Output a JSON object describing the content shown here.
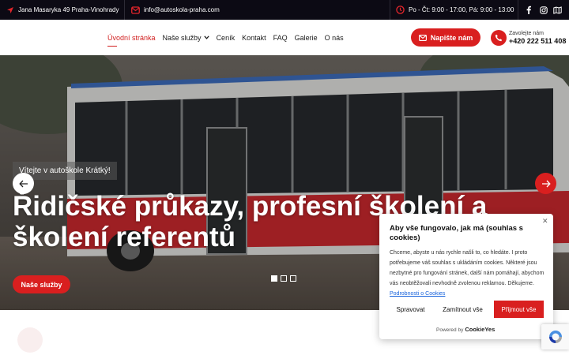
{
  "topbar": {
    "address": "Jana Masaryka 49 Praha-Vinohrady",
    "email": "info@autoskola-praha.com",
    "hours": "Po - Čt: 9:00 - 17:00, Pá: 9:00 - 13:00",
    "social_icons": [
      "facebook-icon",
      "instagram-icon",
      "map-icon"
    ]
  },
  "header": {
    "nav": [
      {
        "label": "Úvodní stránka",
        "active": true
      },
      {
        "label": "Naše služby",
        "dropdown": true
      },
      {
        "label": "Ceník"
      },
      {
        "label": "Kontakt"
      },
      {
        "label": "FAQ"
      },
      {
        "label": "Galerie"
      },
      {
        "label": "O nás"
      }
    ],
    "cta_label": "Napište nám",
    "phone_label": "Zavolejte nám",
    "phone_number": "+420 222 511 408"
  },
  "hero": {
    "tagline": "Vítejte v autoškole Krátký!",
    "title": "Řidičské průkazy, profesní školení a školení referentů",
    "button_label": "Naše služby",
    "slides_count": 3,
    "active_slide": 1
  },
  "cookie": {
    "title": "Aby vše fungovalo, jak má (souhlas s cookies)",
    "text": "Chceme, abyste u nás rychle našli to, co hledáte. I proto potřebujeme váš souhlas s ukládáním cookies. Některé jsou nezbytné pro fungování stránek, další nám pomáhají, abychom vás neobtěžovali nevhodně zvolenou reklamou. Děkujeme.",
    "link_label": "Podrobnosti o Cookies",
    "customize_label": "Spravovat",
    "reject_label": "Zamítnout vše",
    "accept_label": "Přijmout vše",
    "powered_by_label": "Powered by",
    "powered_by_brand": "CookieYes"
  },
  "colors": {
    "accent": "#d91f1f",
    "topbar_bg": "#0c0a14",
    "link": "#1863dc"
  }
}
